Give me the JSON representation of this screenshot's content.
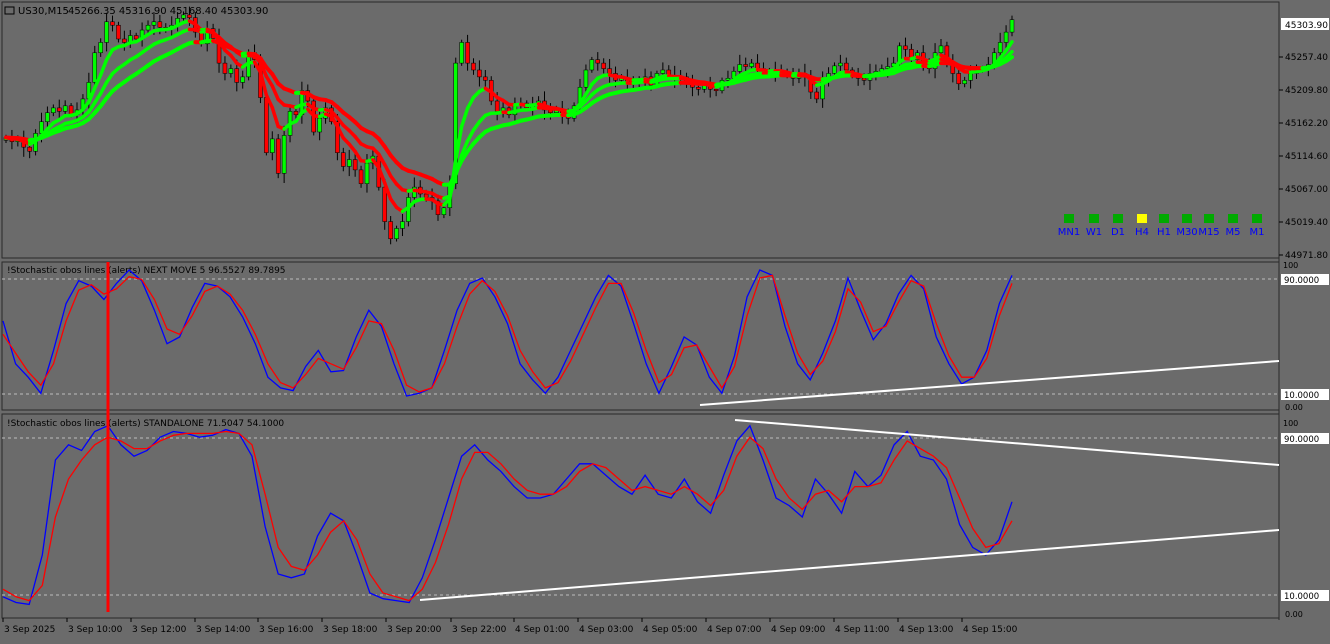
{
  "chart_header": {
    "symbol": "US30,M15",
    "ohlc": "45266.35 45316.90 45168.40 45303.90"
  },
  "main_pane": {
    "price_ticks": [
      "45305.35",
      "45257.40",
      "45209.80",
      "45162.20",
      "45114.60",
      "45067.00",
      "45019.40",
      "44971.80"
    ],
    "current_price": "45303.90",
    "timeframes": [
      {
        "label": "MN1",
        "color": "#00aa00"
      },
      {
        "label": "W1",
        "color": "#00aa00"
      },
      {
        "label": "D1",
        "color": "#00aa00"
      },
      {
        "label": "H4",
        "color": "#ffff00"
      },
      {
        "label": "H1",
        "color": "#00aa00"
      },
      {
        "label": "M30",
        "color": "#00aa00"
      },
      {
        "label": "M15",
        "color": "#00aa00"
      },
      {
        "label": "M5",
        "color": "#00aa00"
      },
      {
        "label": "M1",
        "color": "#00aa00"
      }
    ]
  },
  "stoch1": {
    "title": "!Stochastic obos lines (alerts) NEXT MOVE 5 96.5527 89.7895",
    "axis_top": "100",
    "level_high": "90.0000",
    "level_low": "10.0000",
    "axis_bottom": "0.00"
  },
  "stoch2": {
    "title": "!Stochastic obos lines (alerts) STANDALONE 71.5047 54.1000",
    "axis_top": "100",
    "level_high": "90.0000",
    "level_low": "10.0000",
    "axis_bottom": "0.00"
  },
  "time_axis": [
    "3 Sep 2025",
    "3 Sep 10:00",
    "3 Sep 12:00",
    "3 Sep 14:00",
    "3 Sep 16:00",
    "3 Sep 18:00",
    "3 Sep 20:00",
    "3 Sep 22:00",
    "4 Sep 01:00",
    "4 Sep 03:00",
    "4 Sep 05:00",
    "4 Sep 07:00",
    "4 Sep 09:00",
    "4 Sep 11:00",
    "4 Sep 13:00",
    "4 Sep 15:00"
  ],
  "colors": {
    "background": "#6b6b6b",
    "bull_candle": "#00ff00",
    "bear_candle": "#ff0000",
    "ma_bull": "#00ff00",
    "ma_bear": "#ff0000",
    "stoch_main": "#0000ff",
    "stoch_signal": "#ff0000",
    "trendline": "#ffffff",
    "timeframe_label": "#0000ff"
  },
  "chart_data": [
    {
      "type": "candlestick",
      "title": "US30,M15",
      "ylim": [
        44960,
        45320
      ],
      "close": [
        45132,
        45126,
        45128,
        45118,
        45112,
        45138,
        45155,
        45168,
        45175,
        45170,
        45178,
        45165,
        45172,
        45188,
        45212,
        45255,
        45270,
        45300,
        45295,
        45275,
        45270,
        45280,
        45275,
        45288,
        45295,
        45300,
        45292,
        45290,
        45295,
        45305,
        45310,
        45306,
        45285,
        45268,
        45290,
        45276,
        45240,
        45225,
        45232,
        45212,
        45220,
        45255,
        45245,
        45190,
        45110,
        45130,
        45080,
        45135,
        45170,
        45165,
        45200,
        45185,
        45140,
        45160,
        45175,
        45155,
        45110,
        45090,
        45100,
        45085,
        45065,
        45095,
        45105,
        45060,
        45010,
        44985,
        45000,
        45010,
        45045,
        45060,
        45050,
        45045,
        45040,
        45020,
        45030,
        45065,
        45240,
        45270,
        45240,
        45230,
        45220,
        45215,
        45185,
        45170,
        45175,
        45165,
        45178,
        45182,
        45175,
        45180,
        45185,
        45172,
        45168,
        45172,
        45165,
        45160,
        45178,
        45205,
        45230,
        45245,
        45240,
        45232,
        45225,
        45215,
        45218,
        45212,
        45210,
        45216,
        45220,
        45208,
        45225,
        45230,
        45222,
        45218,
        45220,
        45210,
        45205,
        45202,
        45208,
        45202,
        45200,
        45215,
        45218,
        45228,
        45238,
        45235,
        45240,
        45232,
        45228,
        45225,
        45230,
        45228,
        45222,
        45218,
        45225,
        45220,
        45198,
        45188,
        45215,
        45225,
        45236,
        45240,
        45230,
        45222,
        45218,
        45215,
        45225,
        45228,
        45232,
        45235,
        45240,
        45265,
        45260,
        45245,
        45255,
        45240,
        45232,
        45255,
        45265,
        45240,
        45225,
        45210,
        45215,
        45225,
        45230,
        45232,
        45238,
        45255,
        45270,
        45285,
        45303
      ]
    },
    {
      "type": "line",
      "title": "!Stochastic obos lines (alerts) NEXT MOVE 5",
      "ylim": [
        0,
        100
      ],
      "series": [
        {
          "name": "main",
          "values": [
            62,
            30,
            20,
            8,
            40,
            75,
            92,
            88,
            78,
            90,
            100,
            92,
            70,
            45,
            50,
            72,
            90,
            88,
            80,
            65,
            45,
            20,
            12,
            10,
            28,
            40,
            24,
            25,
            50,
            70,
            58,
            30,
            6,
            8,
            12,
            40,
            70,
            90,
            94,
            80,
            60,
            30,
            18,
            8,
            20,
            40,
            60,
            80,
            96,
            88,
            60,
            30,
            8,
            28,
            50,
            44,
            20,
            8,
            36,
            80,
            100,
            96,
            58,
            30,
            18,
            38,
            62,
            94,
            70,
            48,
            60,
            82,
            96,
            86,
            50,
            30,
            15,
            20,
            40,
            75,
            96
          ]
        },
        {
          "name": "signal",
          "values": [
            52,
            38,
            24,
            14,
            30,
            62,
            85,
            89,
            82,
            86,
            95,
            93,
            78,
            56,
            52,
            66,
            84,
            88,
            82,
            70,
            52,
            30,
            16,
            12,
            22,
            34,
            30,
            26,
            42,
            62,
            60,
            40,
            14,
            9,
            12,
            30,
            58,
            82,
            92,
            84,
            66,
            40,
            24,
            12,
            16,
            32,
            52,
            72,
            90,
            90,
            68,
            40,
            16,
            22,
            42,
            44,
            28,
            12,
            28,
            66,
            94,
            96,
            66,
            38,
            22,
            32,
            54,
            86,
            76,
            54,
            58,
            76,
            92,
            88,
            60,
            36,
            20,
            20,
            34,
            66,
            90
          ]
        }
      ],
      "levels": [
        10,
        90
      ]
    },
    {
      "type": "line",
      "title": "!Stochastic obos lines (alerts) STANDALONE",
      "ylim": [
        0,
        100
      ],
      "series": [
        {
          "name": "main",
          "values": [
            8,
            5,
            4,
            30,
            80,
            88,
            85,
            95,
            98,
            88,
            82,
            85,
            92,
            95,
            94,
            92,
            93,
            96,
            94,
            82,
            45,
            20,
            18,
            20,
            40,
            52,
            48,
            30,
            10,
            7,
            6,
            5,
            18,
            38,
            60,
            82,
            88,
            80,
            74,
            66,
            60,
            60,
            62,
            70,
            78,
            78,
            72,
            66,
            62,
            72,
            62,
            60,
            70,
            58,
            52,
            72,
            90,
            98,
            80,
            60,
            56,
            50,
            70,
            62,
            52,
            74,
            66,
            72,
            88,
            95,
            82,
            80,
            70,
            46,
            34,
            30,
            38,
            58
          ]
        },
        {
          "name": "signal",
          "values": [
            12,
            8,
            6,
            14,
            50,
            70,
            80,
            88,
            92,
            90,
            86,
            86,
            90,
            93,
            94,
            94,
            94,
            95,
            94,
            88,
            62,
            34,
            24,
            22,
            30,
            42,
            48,
            38,
            20,
            10,
            8,
            6,
            12,
            26,
            46,
            70,
            84,
            84,
            78,
            70,
            64,
            62,
            62,
            66,
            74,
            78,
            76,
            70,
            64,
            66,
            64,
            62,
            66,
            62,
            56,
            64,
            82,
            92,
            86,
            70,
            60,
            54,
            62,
            64,
            58,
            66,
            66,
            68,
            80,
            90,
            86,
            82,
            76,
            60,
            44,
            34,
            36,
            48
          ]
        }
      ],
      "levels": [
        10,
        90
      ]
    }
  ]
}
